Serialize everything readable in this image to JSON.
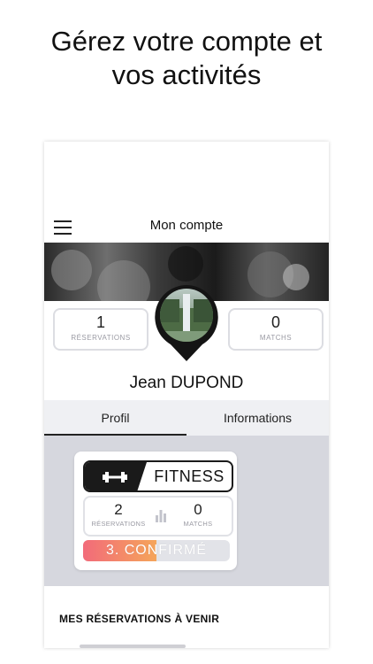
{
  "headline": "Gérez votre compte et\nvos activités",
  "appbar": {
    "title": "Mon compte",
    "menu_icon": "hamburger-menu-icon"
  },
  "profile": {
    "reservations_count": "1",
    "reservations_label": "RÉSERVATIONS",
    "matchs_count": "0",
    "matchs_label": "MATCHS",
    "first_name": "Jean",
    "last_name": "DUPOND"
  },
  "tabs": [
    {
      "label": "Profil",
      "active": true
    },
    {
      "label": "Informations",
      "active": false
    }
  ],
  "sport_card": {
    "sport": "FITNESS",
    "sport_icon": "dumbbell-icon",
    "reservations_count": "2",
    "reservations_label": "RÉSERVATIONS",
    "matchs_count": "0",
    "matchs_label": "MATCHS",
    "level_label": "3. CONFIRMÉ",
    "level_progress": 0.5
  },
  "upcoming": {
    "title": "MES RÉSERVATIONS À VENIR"
  },
  "colors": {
    "accent_start": "#f26b7a",
    "accent_end": "#f5a55a",
    "tabs_bg": "#eff0f3",
    "content_bg": "#d6d7de",
    "dark": "#1a1a1a"
  }
}
